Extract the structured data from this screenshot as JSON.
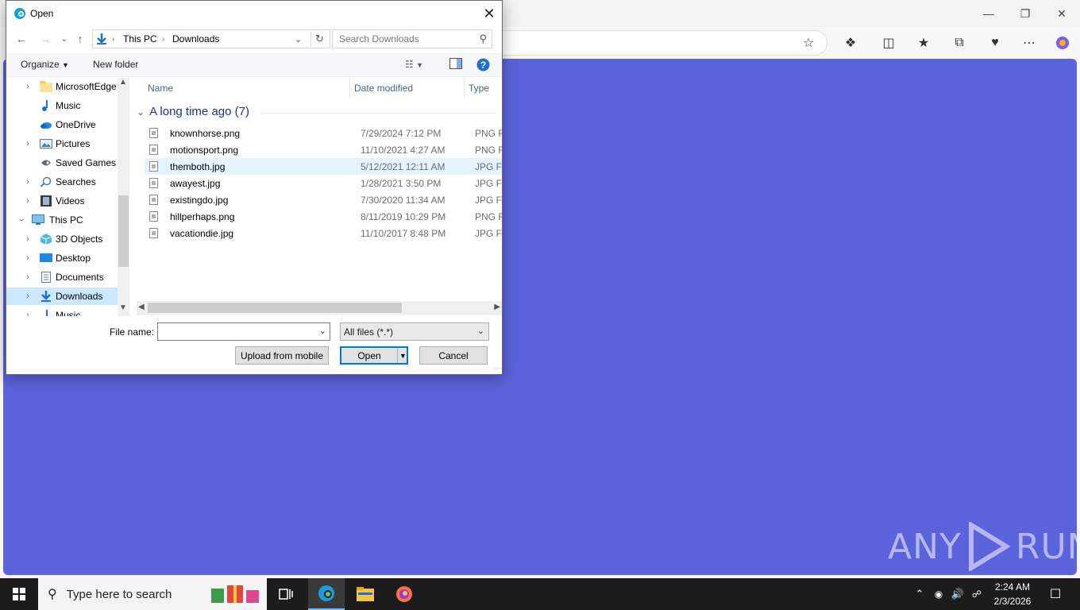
{
  "dialog": {
    "title": "Open",
    "breadcrumb": [
      "This PC",
      "Downloads"
    ],
    "search_placeholder": "Search Downloads",
    "organize_label": "Organize",
    "new_folder_label": "New folder",
    "columns": {
      "name": "Name",
      "date": "Date modified",
      "type": "Type"
    },
    "group_label": "A long time ago (7)",
    "files": [
      {
        "name": "knownhorse.png",
        "date": "7/29/2024 7:12 PM",
        "type": "PNG File"
      },
      {
        "name": "motionsport.png",
        "date": "11/10/2021 4:27 AM",
        "type": "PNG File"
      },
      {
        "name": "themboth.jpg",
        "date": "5/12/2021 12:11 AM",
        "type": "JPG File"
      },
      {
        "name": "awayest.jpg",
        "date": "1/28/2021 3:50 PM",
        "type": "JPG File"
      },
      {
        "name": "existingdo.jpg",
        "date": "7/30/2020 11:34 AM",
        "type": "JPG File"
      },
      {
        "name": "hillperhaps.png",
        "date": "8/11/2019 10:29 PM",
        "type": "PNG File"
      },
      {
        "name": "vacationdie.jpg",
        "date": "11/10/2017 8:48 PM",
        "type": "JPG File"
      }
    ],
    "nav_items": [
      {
        "label": "MicrosoftEdge",
        "icon": "folder-icon"
      },
      {
        "label": "Music",
        "icon": "music-icon"
      },
      {
        "label": "OneDrive",
        "icon": "onedrive-icon"
      },
      {
        "label": "Pictures",
        "icon": "pictures-icon"
      },
      {
        "label": "Saved Games",
        "icon": "saved-games-icon"
      },
      {
        "label": "Searches",
        "icon": "search-icon"
      },
      {
        "label": "Videos",
        "icon": "videos-icon"
      },
      {
        "label": "This PC",
        "icon": "computer-icon"
      },
      {
        "label": "3D Objects",
        "icon": "3d-objects-icon"
      },
      {
        "label": "Desktop",
        "icon": "desktop-icon"
      },
      {
        "label": "Documents",
        "icon": "documents-icon"
      },
      {
        "label": "Downloads",
        "icon": "downloads-icon"
      },
      {
        "label": "Music",
        "icon": "music-icon"
      }
    ],
    "file_name_label": "File name:",
    "file_name_value": "",
    "file_type_value": "All files (*.*)",
    "upload_label": "Upload from mobile",
    "open_label": "Open",
    "cancel_label": "Cancel"
  },
  "taskbar": {
    "search_placeholder": "Type here to search",
    "time": "2:24 AM",
    "date": "2/3/2026"
  },
  "watermark": {
    "text_left": "ANY",
    "text_right": "RUN"
  },
  "colors": {
    "page_bg": "#5b63dc",
    "selected": "#cce8ff",
    "accent": "#0078d7"
  }
}
